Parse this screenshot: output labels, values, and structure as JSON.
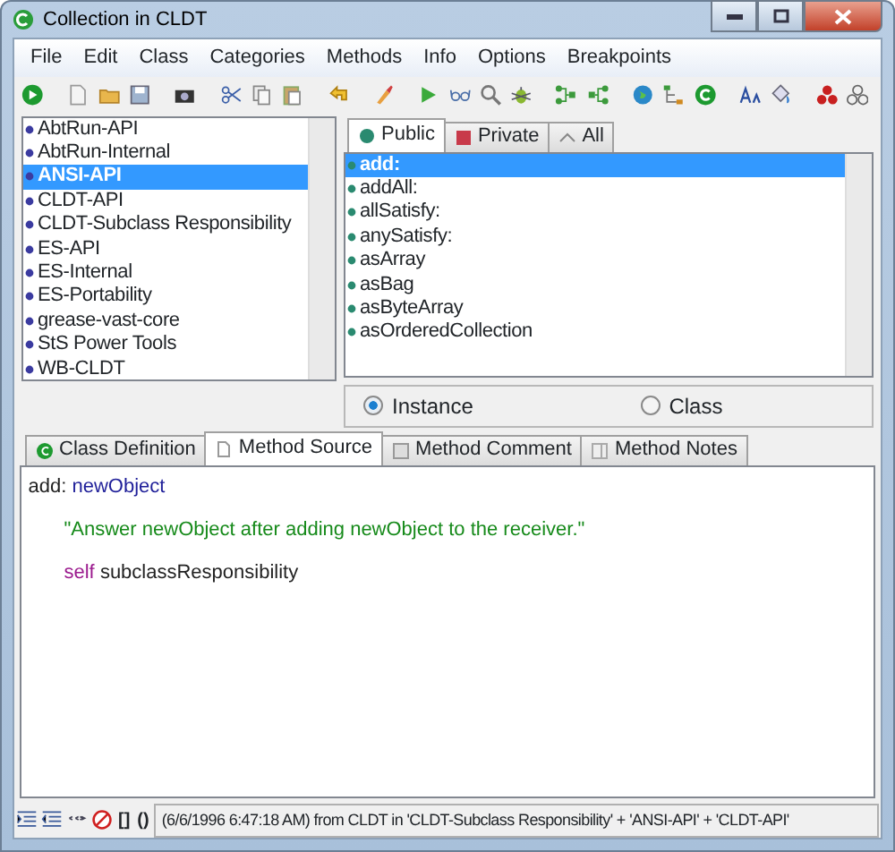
{
  "window": {
    "title": "Collection in CLDT"
  },
  "menu": [
    "File",
    "Edit",
    "Class",
    "Categories",
    "Methods",
    "Info",
    "Options",
    "Breakpoints"
  ],
  "categories": [
    {
      "label": "AbtRun-API",
      "selected": false
    },
    {
      "label": "AbtRun-Internal",
      "selected": false
    },
    {
      "label": "ANSI-API",
      "selected": true
    },
    {
      "label": "CLDT-API",
      "selected": false
    },
    {
      "label": "CLDT-Subclass Responsibility",
      "selected": false
    },
    {
      "label": "ES-API",
      "selected": false
    },
    {
      "label": "ES-Internal",
      "selected": false
    },
    {
      "label": "ES-Portability",
      "selected": false
    },
    {
      "label": "grease-vast-core",
      "selected": false
    },
    {
      "label": "StS Power Tools",
      "selected": false
    },
    {
      "label": "WB-CLDT",
      "selected": false
    }
  ],
  "method_tabs": [
    {
      "label": "Public",
      "selected": true,
      "kind": "public"
    },
    {
      "label": "Private",
      "selected": false,
      "kind": "private"
    },
    {
      "label": "All",
      "selected": false,
      "kind": "all"
    }
  ],
  "methods": [
    {
      "label": "add:",
      "selected": true
    },
    {
      "label": "addAll:",
      "selected": false
    },
    {
      "label": "allSatisfy:",
      "selected": false
    },
    {
      "label": "anySatisfy:",
      "selected": false
    },
    {
      "label": "asArray",
      "selected": false
    },
    {
      "label": "asBag",
      "selected": false
    },
    {
      "label": "asByteArray",
      "selected": false
    },
    {
      "label": "asOrderedCollection",
      "selected": false
    }
  ],
  "side": [
    {
      "label": "Instance",
      "selected": true
    },
    {
      "label": "Class",
      "selected": false
    }
  ],
  "editor_tabs": [
    {
      "label": "Class Definition",
      "selected": false,
      "kind": "class"
    },
    {
      "label": "Method Source",
      "selected": true,
      "kind": "doc"
    },
    {
      "label": "Method Comment",
      "selected": false,
      "kind": "clip"
    },
    {
      "label": "Method Notes",
      "selected": false,
      "kind": "notes"
    }
  ],
  "source": [
    [
      {
        "text": "add:",
        "kind": "selector"
      },
      {
        "text": "newObject",
        "kind": "argument"
      }
    ],
    [
      {
        "text": "\"Answer newObject after adding newObject to the receiver.\"",
        "kind": "comment"
      }
    ],
    [
      {
        "text": "self",
        "kind": "keyword"
      },
      {
        "text": "subclassResponsibility",
        "kind": "plain"
      }
    ]
  ],
  "status_bar": {
    "brackets": "[]",
    "parens": "()",
    "message": "(6/6/1996 6:47:18 AM) from CLDT in 'CLDT-Subclass Responsibility' + 'ANSI-API' + 'CLDT-API'"
  }
}
